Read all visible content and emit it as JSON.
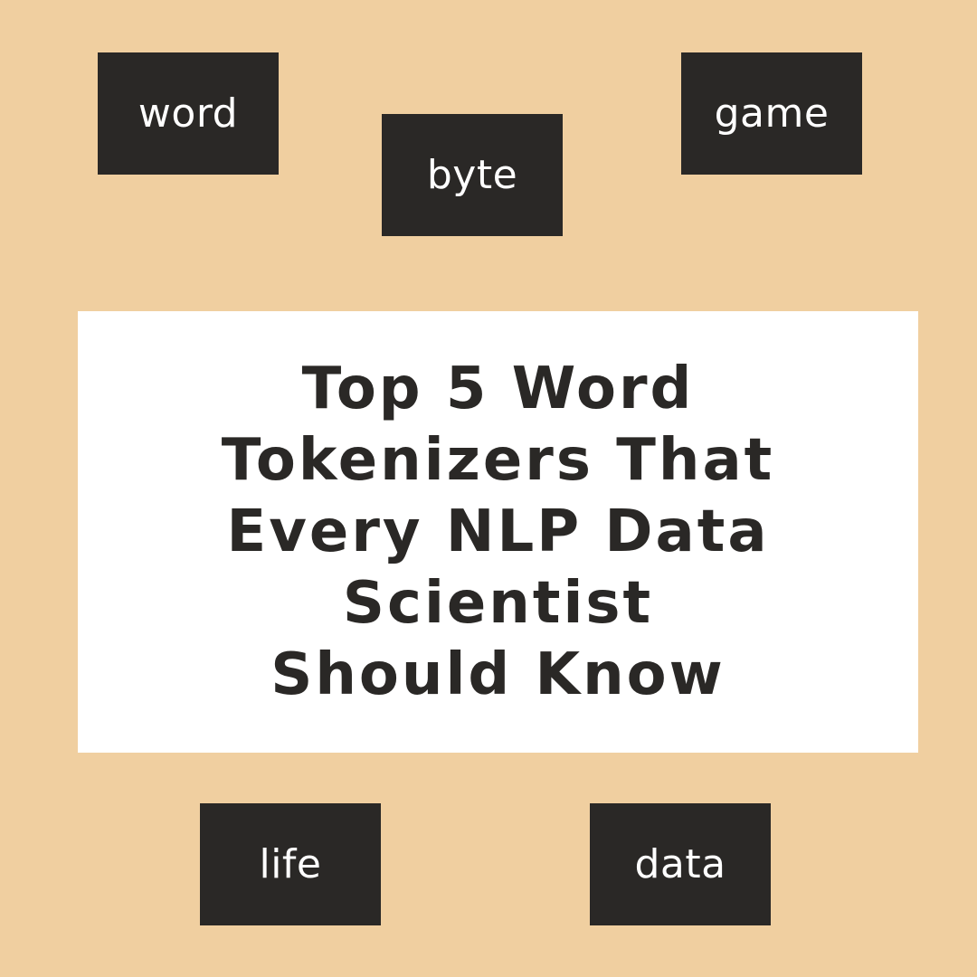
{
  "colors": {
    "background": "#f0cfa0",
    "box": "#2a2826",
    "box_text": "#ffffff",
    "panel": "#ffffff",
    "title_text": "#2a2826"
  },
  "tokens": {
    "word": "word",
    "byte": "byte",
    "game": "game",
    "life": "life",
    "data": "data"
  },
  "title": {
    "lines": [
      "Top 5 Word",
      "Tokenizers That",
      "Every NLP Data",
      "Scientist",
      "Should Know"
    ]
  }
}
